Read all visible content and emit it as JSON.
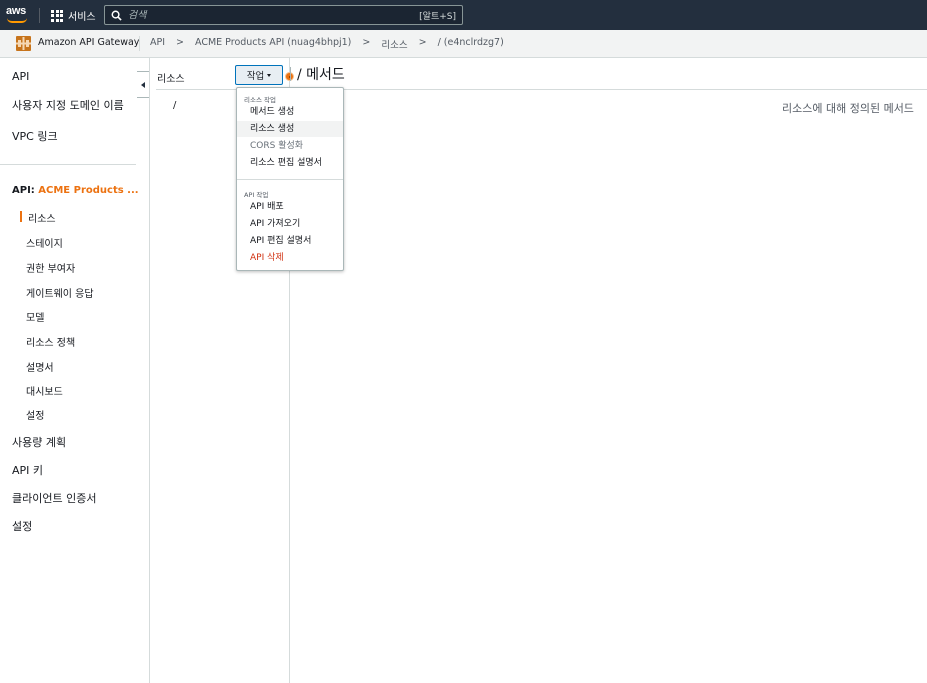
{
  "topnav": {
    "logo": "aws",
    "services_label": "서비스",
    "search_placeholder": "검색",
    "search_shortcut": "[알트+S]"
  },
  "breadcrumb": {
    "service_name": "Amazon API Gateway",
    "items": [
      "API",
      "ACME Products API (nuag4bhpj1)",
      "리소스",
      "/ (e4nclrdzg7)"
    ],
    "separator": ">"
  },
  "sidebar": {
    "top_items": [
      "API",
      "사용자 지정 도메인 이름",
      "VPC 링크"
    ],
    "api_prefix": "API:",
    "api_name": "ACME Products ...",
    "sub_items": [
      "리소스",
      "스테이지",
      "권한 부여자",
      "게이트웨이 응답",
      "모델",
      "리소스 정책",
      "설명서",
      "대시보드",
      "설정"
    ],
    "bottom_items": [
      "사용량 계획",
      "API 키",
      "클라이언트 인증서",
      "설정"
    ],
    "active_item": "리소스"
  },
  "resources": {
    "title": "리소스",
    "root": "/"
  },
  "actions": {
    "label": "작업",
    "menu": {
      "resource_header": "리소스 작업",
      "resource_items": [
        "메서드 생성",
        "리소스 생성",
        "CORS 활성화",
        "리소스 편집 설명서"
      ],
      "api_header": "API 작업",
      "api_items": [
        "API 배포",
        "API 가져오기",
        "API 편집 설명서",
        "API 삭제"
      ]
    }
  },
  "main": {
    "title": "/ 메서드",
    "empty_text": "리소스에 대해 정의된 메서드"
  },
  "colors": {
    "nav_bg": "#232f3e",
    "accent": "#ec7211",
    "danger": "#d13212",
    "link": "#0073bb"
  }
}
